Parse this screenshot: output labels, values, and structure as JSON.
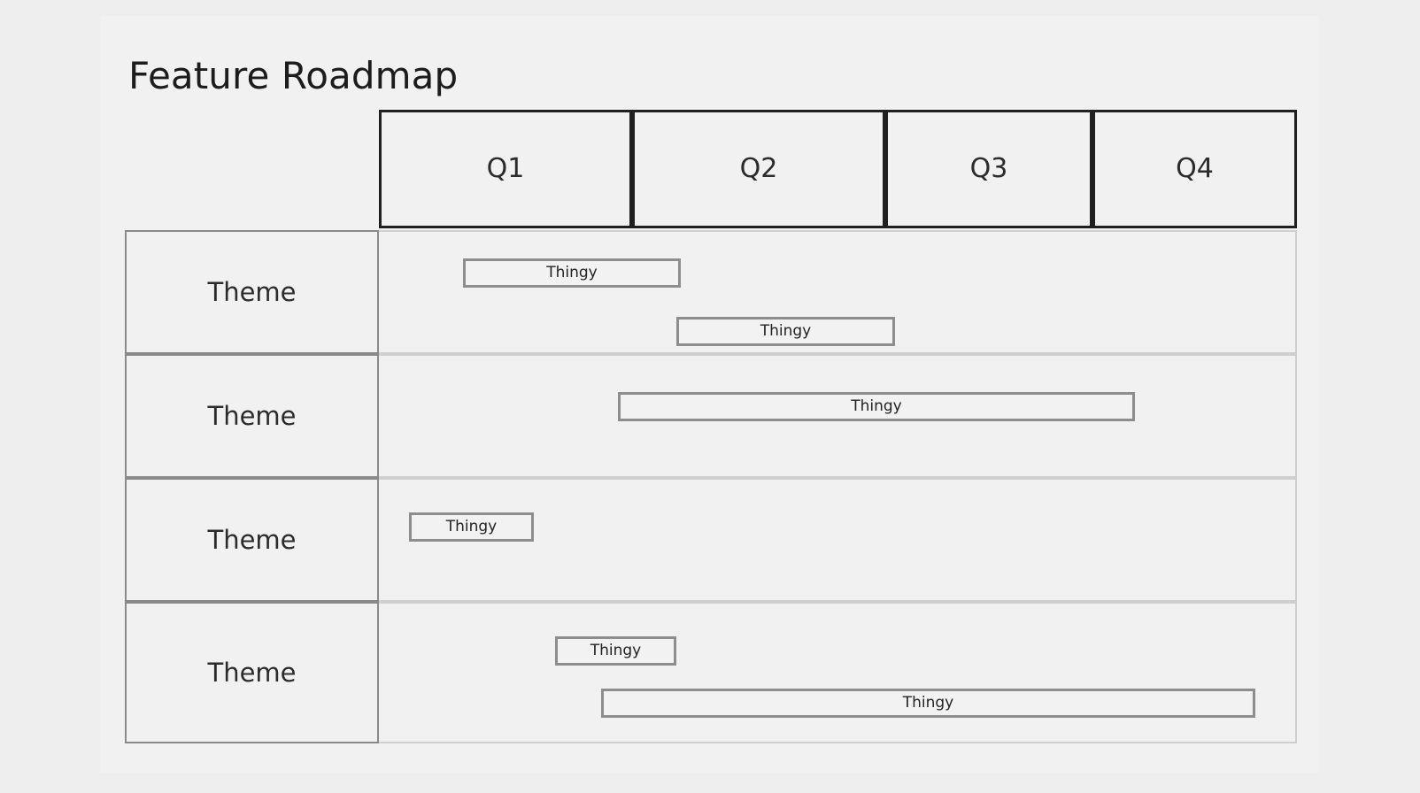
{
  "slide": {
    "title": "Feature Roadmap",
    "background": "#f1f1f1",
    "page_background": "#eeeeee"
  },
  "timeline": {
    "header_border_color": "#1f1f1f",
    "columns": [
      {
        "label": "Q1"
      },
      {
        "label": "Q2"
      },
      {
        "label": "Q3"
      },
      {
        "label": "Q4"
      }
    ]
  },
  "rows": [
    {
      "theme_label": "Theme",
      "bars": [
        {
          "label": "Thingy"
        },
        {
          "label": "Thingy"
        }
      ]
    },
    {
      "theme_label": "Theme",
      "bars": [
        {
          "label": "Thingy"
        }
      ]
    },
    {
      "theme_label": "Theme",
      "bars": [
        {
          "label": "Thingy"
        }
      ]
    },
    {
      "theme_label": "Theme",
      "bars": [
        {
          "label": "Thingy"
        },
        {
          "label": "Thingy"
        }
      ]
    }
  ],
  "chart_data": {
    "type": "bar",
    "title": "Feature Roadmap",
    "xlabel": "",
    "ylabel": "",
    "categories": [
      "Q1",
      "Q2",
      "Q3",
      "Q4"
    ],
    "grid": true,
    "legend": "none",
    "swimlanes": [
      {
        "name": "Theme",
        "items": [
          {
            "label": "Thingy",
            "start_quarter": 1.4,
            "end_quarter": 2.25
          },
          {
            "label": "Thingy",
            "start_quarter": 2.25,
            "end_quarter": 3.1
          }
        ]
      },
      {
        "name": "Theme",
        "items": [
          {
            "label": "Thingy",
            "start_quarter": 2.0,
            "end_quarter": 4.05
          }
        ]
      },
      {
        "name": "Theme",
        "items": [
          {
            "label": "Thingy",
            "start_quarter": 1.16,
            "end_quarter": 1.65
          }
        ]
      },
      {
        "name": "Theme",
        "items": [
          {
            "label": "Thingy",
            "start_quarter": 1.75,
            "end_quarter": 2.17
          },
          {
            "label": "Thingy",
            "start_quarter": 1.93,
            "end_quarter": 4.52
          }
        ]
      }
    ]
  }
}
